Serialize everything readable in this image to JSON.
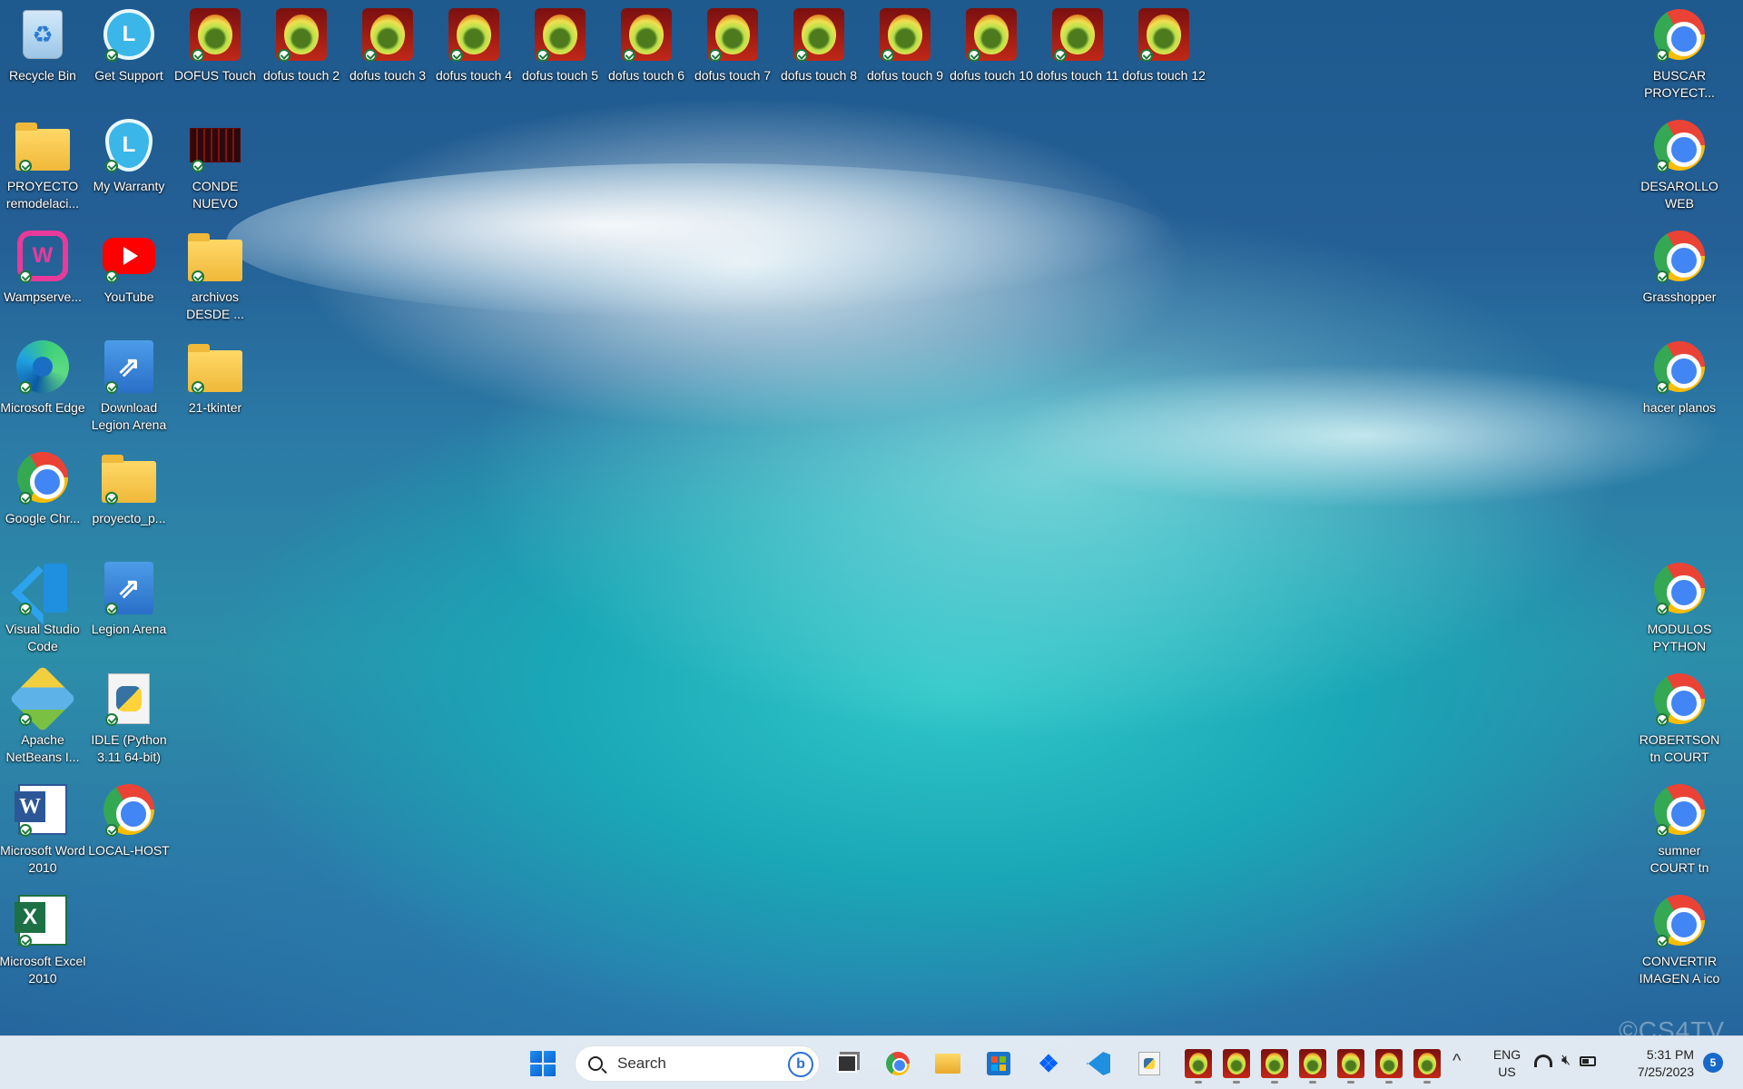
{
  "desktop": {
    "watermark": "©CS4TV",
    "icons": [
      {
        "label": "Recycle Bin",
        "icon": "recycle-bin-icon"
      },
      {
        "label": "Get Support",
        "icon": "support-icon"
      },
      {
        "label": "DOFUS Touch",
        "icon": "dofus-icon"
      },
      {
        "label": "dofus touch 2",
        "icon": "dofus-icon"
      },
      {
        "label": "dofus touch 3",
        "icon": "dofus-icon"
      },
      {
        "label": "dofus touch 4",
        "icon": "dofus-icon"
      },
      {
        "label": "dofus touch 5",
        "icon": "dofus-icon"
      },
      {
        "label": "dofus touch 6",
        "icon": "dofus-icon"
      },
      {
        "label": "dofus touch 7",
        "icon": "dofus-icon"
      },
      {
        "label": "dofus touch 8",
        "icon": "dofus-icon"
      },
      {
        "label": "dofus touch 9",
        "icon": "dofus-icon"
      },
      {
        "label": "dofus touch 10",
        "icon": "dofus-icon"
      },
      {
        "label": "dofus touch 11",
        "icon": "dofus-icon"
      },
      {
        "label": "dofus touch 12",
        "icon": "dofus-icon"
      },
      {
        "label": "BUSCAR PROYECT...",
        "icon": "chrome-icon"
      },
      {
        "label": "PROYECTO remodelaci...",
        "icon": "folder-icon"
      },
      {
        "label": "My Warranty",
        "icon": "warranty-icon"
      },
      {
        "label": "CONDE NUEVO",
        "icon": "app-icon"
      },
      {
        "label": "DESAROLLO WEB",
        "icon": "chrome-icon"
      },
      {
        "label": "Wampserve...",
        "icon": "wampserver-icon"
      },
      {
        "label": "YouTube",
        "icon": "youtube-icon"
      },
      {
        "label": "archivos DESDE ...",
        "icon": "folder-icon"
      },
      {
        "label": "Grasshopper",
        "icon": "chrome-icon"
      },
      {
        "label": "Microsoft Edge",
        "icon": "edge-icon"
      },
      {
        "label": "Download Legion Arena",
        "icon": "legion-icon"
      },
      {
        "label": "21-tkinter",
        "icon": "folder-icon"
      },
      {
        "label": "hacer planos",
        "icon": "chrome-icon"
      },
      {
        "label": "Google Chr...",
        "icon": "chrome-icon"
      },
      {
        "label": "proyecto_p...",
        "icon": "folder-icon"
      },
      {
        "label": "Visual Studio Code",
        "icon": "vscode-icon"
      },
      {
        "label": "Legion Arena",
        "icon": "legion-icon"
      },
      {
        "label": "MODULOS PYTHON",
        "icon": "chrome-icon"
      },
      {
        "label": "Apache NetBeans I...",
        "icon": "netbeans-icon"
      },
      {
        "label": "IDLE (Python 3.11 64-bit)",
        "icon": "python-icon"
      },
      {
        "label": "ROBERTSON tn COURT",
        "icon": "chrome-icon"
      },
      {
        "label": "Microsoft Word 2010",
        "icon": "word-icon"
      },
      {
        "label": "LOCAL-HOST",
        "icon": "chrome-icon"
      },
      {
        "label": "sumner COURT tn",
        "icon": "chrome-icon"
      },
      {
        "label": "Microsoft Excel 2010",
        "icon": "excel-icon"
      },
      {
        "label": "CONVERTIR IMAGEN A ico",
        "icon": "chrome-icon"
      }
    ]
  },
  "taskbar": {
    "search_placeholder": "Search",
    "bing_label": "b",
    "pinned": [
      "start-icon",
      "search",
      "task-view-icon",
      "chrome-icon",
      "file-explorer-icon",
      "store-icon",
      "dropbox-icon",
      "vscode-icon",
      "python-icon"
    ],
    "running_dofus_count": 7,
    "tray": {
      "chevron": "^",
      "lang_line1": "ENG",
      "lang_line2": "US",
      "time": "5:31 PM",
      "date": "7/25/2023",
      "notifications": "5"
    }
  }
}
